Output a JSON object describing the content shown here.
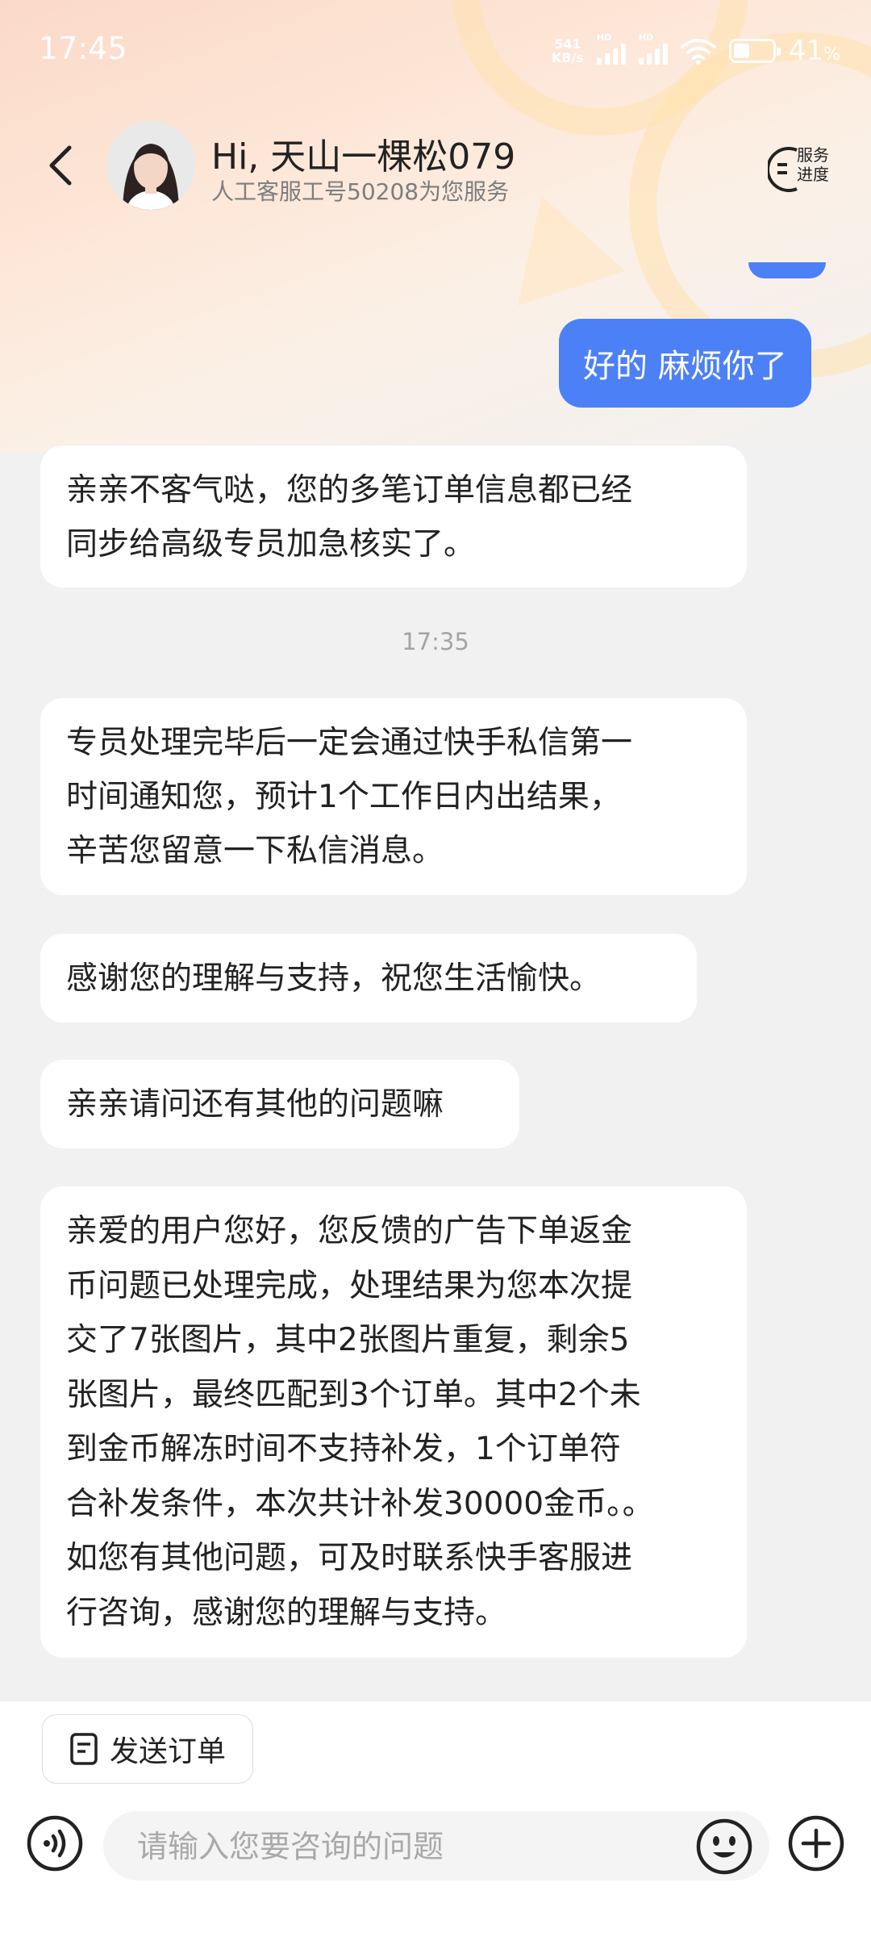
{
  "status_bar": {
    "time": "17:45",
    "net_speed_value": "541",
    "net_speed_unit": "KB/s",
    "signal_label": "HD",
    "battery_percent": "41",
    "battery_percent_suffix": "%",
    "battery_level": 0.41
  },
  "header": {
    "title": "Hi, 天山一棵松079",
    "subtitle": "人工客服工号50208为您服务",
    "service_progress_label_line1": "服务",
    "service_progress_label_line2": "进度"
  },
  "messages": [
    {
      "side": "right",
      "text": "好的 麻烦你了"
    },
    {
      "side": "left",
      "lines": [
        "亲亲不客气哒，您的多笔订单信息都已经",
        "同步给高级专员加急核实了。"
      ]
    },
    {
      "side": "center",
      "text": "17:35"
    },
    {
      "side": "left",
      "lines": [
        "专员处理完毕后一定会通过快手私信第一",
        "时间通知您，预计1个工作日内出结果，",
        "辛苦您留意一下私信消息。"
      ]
    },
    {
      "side": "left",
      "lines": [
        "感谢您的理解与支持，祝您生活愉快。"
      ]
    },
    {
      "side": "left",
      "lines": [
        "亲亲请问还有其他的问题嘛"
      ]
    },
    {
      "side": "left",
      "lines": [
        "亲爱的用户您好，您反馈的广告下单返金",
        "币问题已处理完成，处理结果为您本次提",
        "交了7张图片，其中2张图片重复，剩余5",
        "张图片，最终匹配到3个订单。其中2个未",
        "到金币解冻时间不支持补发，1个订单符",
        "合补发条件，本次共计补发30000金币。。",
        "如您有其他问题，可及时联系快手客服进",
        "行咨询，感谢您的理解与支持。"
      ]
    }
  ],
  "bottom": {
    "send_order_label": "发送订单",
    "input_placeholder": "请输入您要咨询的问题",
    "input_value": ""
  },
  "colors": {
    "accent": "#4c80f6",
    "bubble_left": "#ffffff",
    "chat_background": "#f1f1f1"
  },
  "icons": [
    "back-arrow-icon",
    "avatar",
    "service-progress-icon",
    "order-doc-icon",
    "voice-icon",
    "emoji-icon",
    "plus-icon"
  ]
}
